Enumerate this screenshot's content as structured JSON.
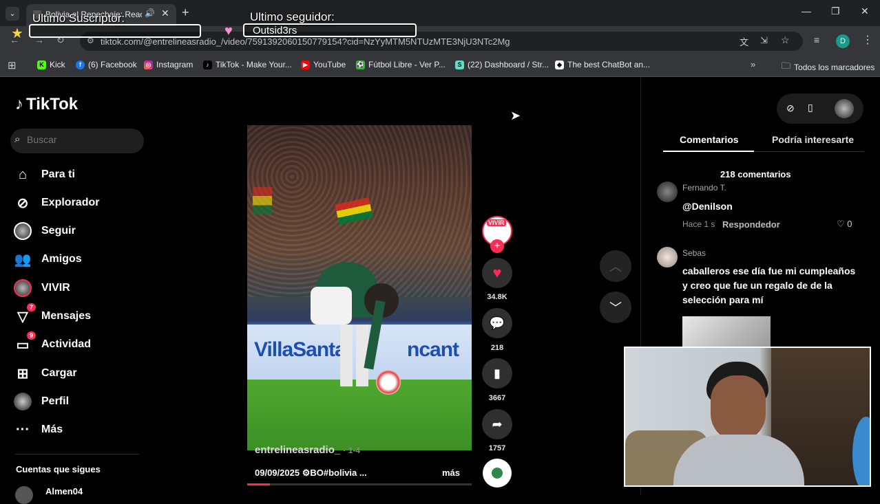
{
  "browser": {
    "tab_title": "Bolivia al Repechaje: Reacci",
    "url": "tiktok.com/@entrelineasradio_/video/7591392060150779154?cid=NzYyMTM5NTUzMTE3NjU3NTc2Mg",
    "bookmarks": [
      "Kick",
      "(6) Facebook",
      "Instagram",
      "TikTok - Make Your...",
      "YouTube",
      "Fútbol Libre - Ver P...",
      "(22) Dashboard / Str...",
      "The best ChatBot an..."
    ],
    "all_bookmarks": "Todos los marcadores",
    "profile_initial": "D"
  },
  "overlay": {
    "subscriber_label": "Ultimo Suscriptor:",
    "follower_label": "Ultimo seguidor:",
    "follower_name": "Outsid3rs"
  },
  "tiktok": {
    "logo": "TikTok",
    "search_placeholder": "Buscar",
    "nav": [
      {
        "label": "Para ti"
      },
      {
        "label": "Explorador"
      },
      {
        "label": "Seguir"
      },
      {
        "label": "Amigos"
      },
      {
        "label": "VIVIR"
      },
      {
        "label": "Mensajes",
        "badge": "7"
      },
      {
        "label": "Actividad",
        "badge": "9"
      },
      {
        "label": "Cargar"
      },
      {
        "label": "Perfil"
      },
      {
        "label": "Más"
      }
    ],
    "following_header": "Cuentas que sigues",
    "following_first": "Almen04"
  },
  "video": {
    "author": "entrelineasradio_",
    "author_suffix": "· 1-4",
    "date": "09/09/2025",
    "caption": "BO#bolivia ...",
    "more": "más",
    "live_badge": "VIVIR",
    "likes": "34.8K",
    "comments": "218",
    "saves": "3667",
    "shares": "1757",
    "ad_text_left": "VillaSanta",
    "ad_text_right": "ncant"
  },
  "panel": {
    "tab_comments": "Comentarios",
    "tab_suggested": "Podría interesarte",
    "count": "218 comentarios",
    "comments": [
      {
        "name": "Fernando T.",
        "text": "@‍Denilson",
        "time": "Hace 1 s",
        "reply": "Respondedor",
        "likes": "0"
      },
      {
        "name": "Sebas",
        "text": "caballeros ese día fue mi cumpleaños y creo que fue un regalo de de la selección para mí"
      }
    ]
  },
  "colors": {
    "accent": "#fe2c55",
    "bg": "#000000",
    "chrome_dark": "#202124",
    "chrome_mid": "#35363a"
  }
}
